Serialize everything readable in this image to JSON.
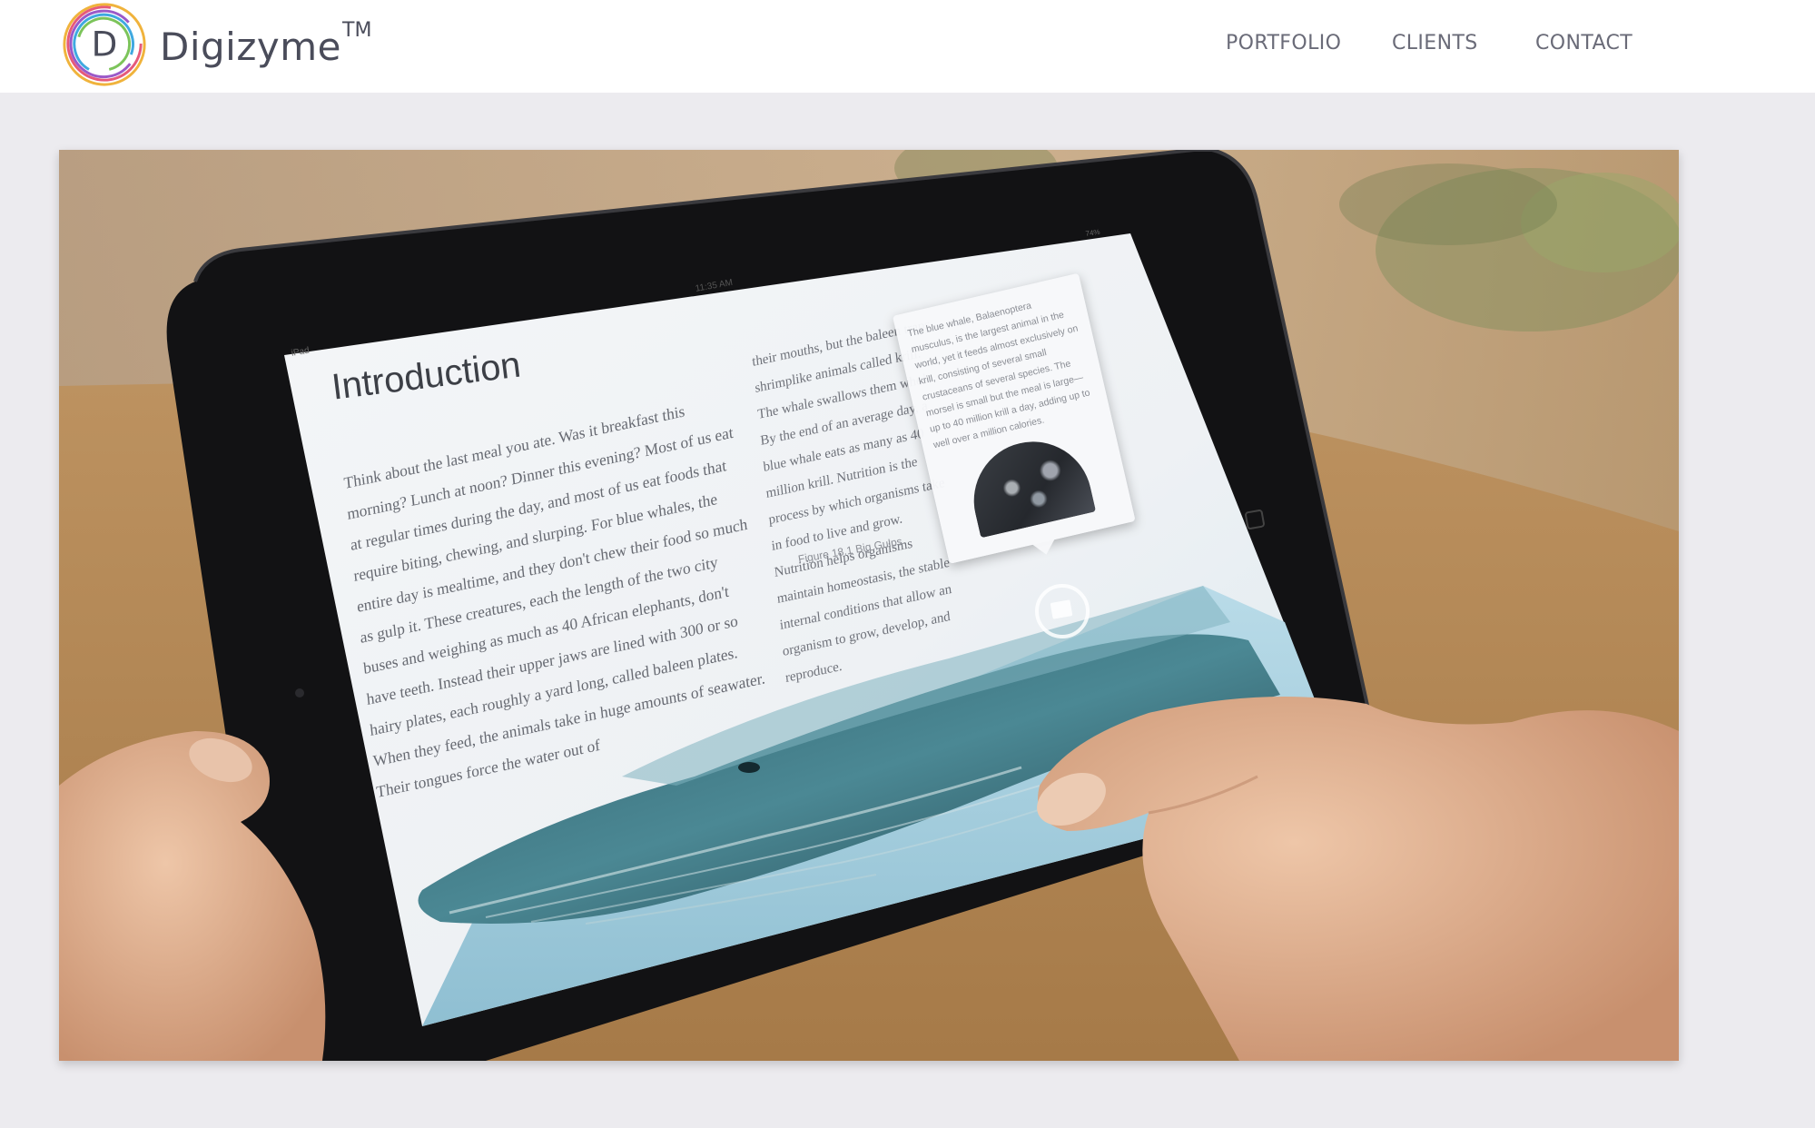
{
  "header": {
    "logo": {
      "text": "Digizyme",
      "tm": "TM"
    },
    "nav": [
      {
        "label": "PORTFOLIO"
      },
      {
        "label": "CLIENTS"
      },
      {
        "label": "CONTACT"
      }
    ]
  },
  "hero": {
    "device": {
      "status_left": "iPad",
      "status_time": "11:35 AM",
      "status_battery": "74%"
    },
    "book": {
      "title": "Introduction",
      "body": "Think about the last meal you ate. Was it breakfast this morning? Lunch at noon? Dinner this evening? Most of us eat at regular times during the day, and most of us eat foods that require biting, chewing, and slurping. For blue whales, the entire day is mealtime, and they don't chew their food so much as gulp it. These creatures, each the length of the two city buses and weighing as much as 40 African elephants, don't have teeth. Instead their upper jaws are lined with 300 or so hairy plates, each roughly a yard long, called baleen plates. When they feed, the animals take in huge amounts of seawater. Their tongues force the water out of",
      "column2": "their mouths, but the baleen traps shrimplike animals called krill. The whale swallows them whole. By the end of an average day, a blue whale eats as many as 40 million krill. Nutrition is the process by which organisms take in food to live and grow. Nutrition helps organisms maintain homeostasis, the stable internal conditions that allow an organism to grow, develop, and reproduce.",
      "figure_caption": "Figure 18.1 Big Gulps",
      "popover_text": "The blue whale, Balaenoptera musculus, is the largest animal in the world, yet it feeds almost exclusively on krill, consisting of several small crustaceans of several species. The morsel is small but the meal is large—up to 40 million krill a day, adding up to well over a million calories."
    }
  },
  "colors": {
    "header_bg": "#ffffff",
    "page_bg": "#ecebef",
    "nav_text": "#6a6b78",
    "logo_text": "#4a4c5a"
  }
}
